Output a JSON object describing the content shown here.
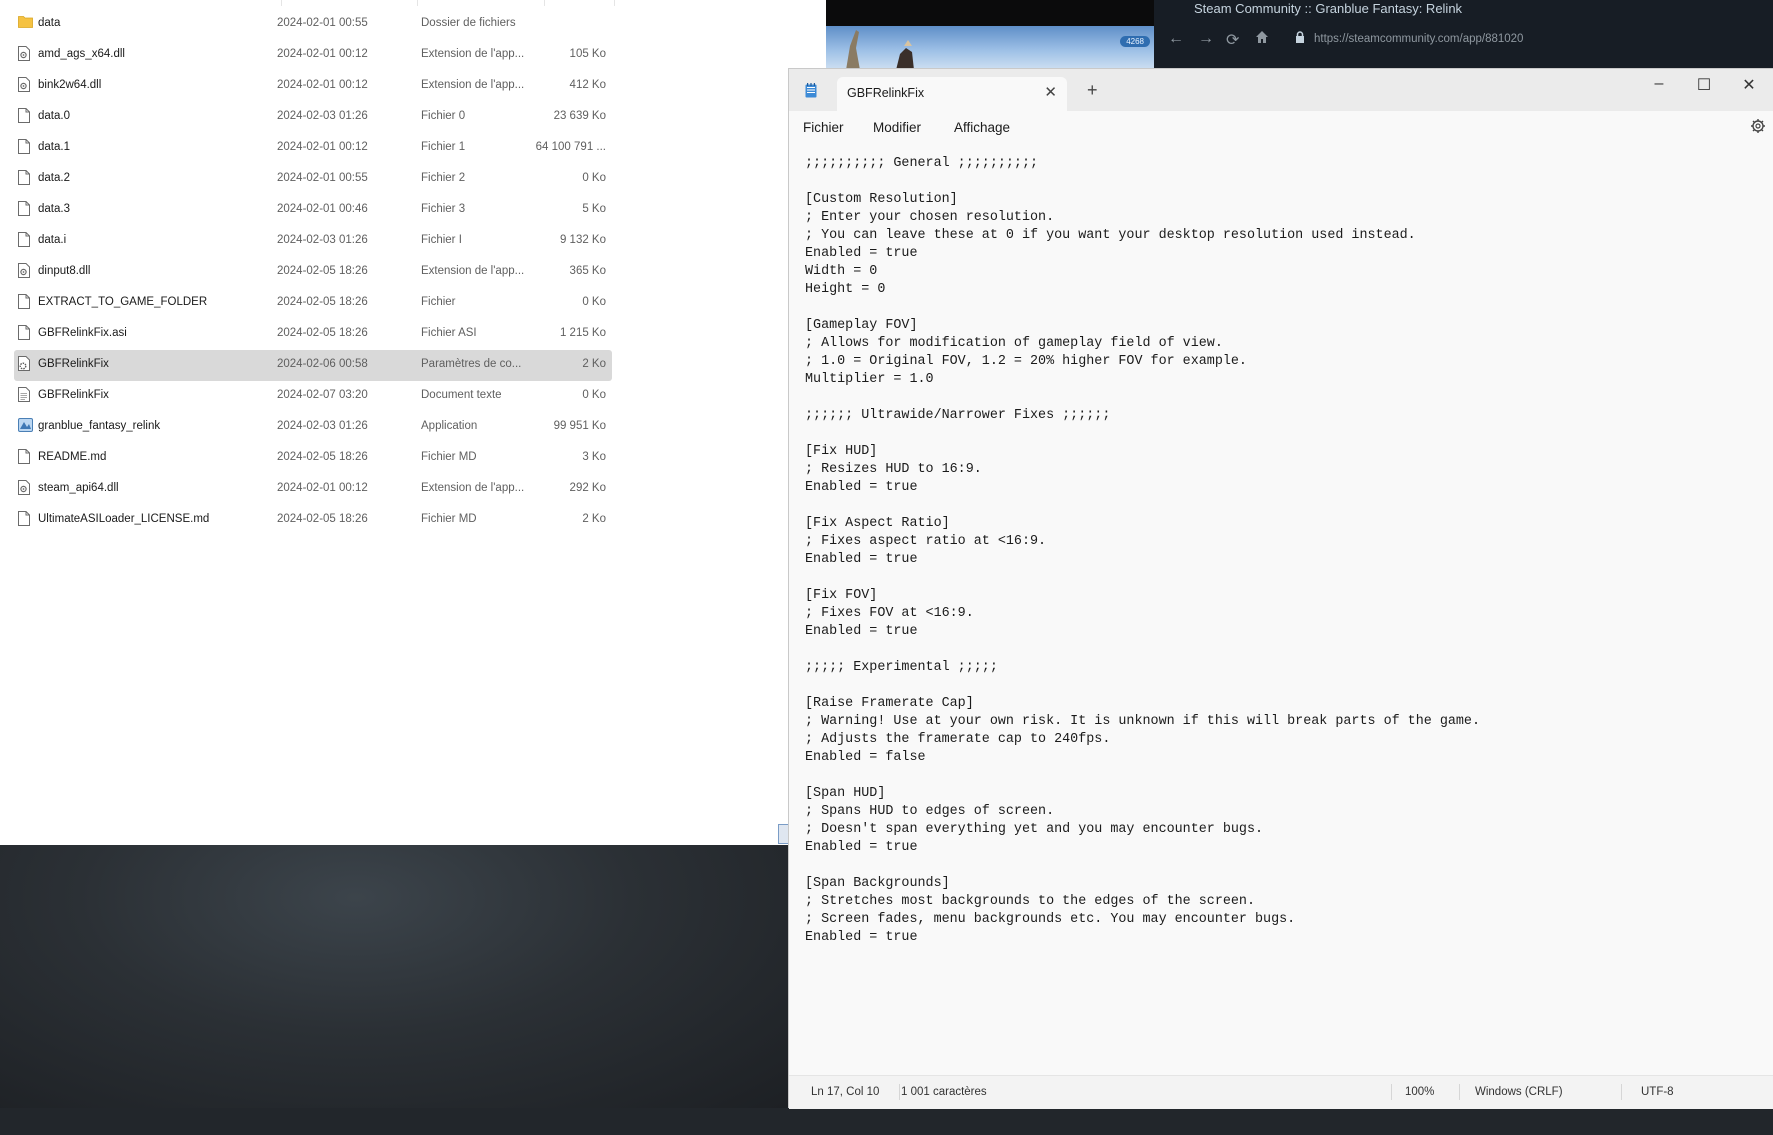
{
  "explorer": {
    "files": [
      {
        "name": "data",
        "date": "2024-02-01 00:55",
        "type": "Dossier de fichiers",
        "size": "",
        "icon": "folder-icon"
      },
      {
        "name": "amd_ags_x64.dll",
        "date": "2024-02-01 00:12",
        "type": "Extension de l'app...",
        "size": "105 Ko",
        "icon": "dll-file-icon"
      },
      {
        "name": "bink2w64.dll",
        "date": "2024-02-01 00:12",
        "type": "Extension de l'app...",
        "size": "412 Ko",
        "icon": "dll-file-icon"
      },
      {
        "name": "data.0",
        "date": "2024-02-03 01:26",
        "type": "Fichier 0",
        "size": "23 639 Ko",
        "icon": "file-icon"
      },
      {
        "name": "data.1",
        "date": "2024-02-01 00:12",
        "type": "Fichier 1",
        "size": "64 100 791 ...",
        "icon": "file-icon"
      },
      {
        "name": "data.2",
        "date": "2024-02-01 00:55",
        "type": "Fichier 2",
        "size": "0 Ko",
        "icon": "file-icon"
      },
      {
        "name": "data.3",
        "date": "2024-02-01 00:46",
        "type": "Fichier 3",
        "size": "5 Ko",
        "icon": "file-icon"
      },
      {
        "name": "data.i",
        "date": "2024-02-03 01:26",
        "type": "Fichier I",
        "size": "9 132 Ko",
        "icon": "file-icon"
      },
      {
        "name": "dinput8.dll",
        "date": "2024-02-05 18:26",
        "type": "Extension de l'app...",
        "size": "365 Ko",
        "icon": "dll-file-icon"
      },
      {
        "name": "EXTRACT_TO_GAME_FOLDER",
        "date": "2024-02-05 18:26",
        "type": "Fichier",
        "size": "0 Ko",
        "icon": "file-icon"
      },
      {
        "name": "GBFRelinkFix.asi",
        "date": "2024-02-05 18:26",
        "type": "Fichier ASI",
        "size": "1 215 Ko",
        "icon": "file-icon"
      },
      {
        "name": "GBFRelinkFix",
        "date": "2024-02-06 00:58",
        "type": "Paramètres de co...",
        "size": "2 Ko",
        "icon": "settings-file-icon",
        "selected": true
      },
      {
        "name": "GBFRelinkFix",
        "date": "2024-02-07 03:20",
        "type": "Document texte",
        "size": "0 Ko",
        "icon": "text-file-icon"
      },
      {
        "name": "granblue_fantasy_relink",
        "date": "2024-02-03 01:26",
        "type": "Application",
        "size": "99 951 Ko",
        "icon": "app-icon"
      },
      {
        "name": "README.md",
        "date": "2024-02-05 18:26",
        "type": "Fichier MD",
        "size": "3 Ko",
        "icon": "file-icon"
      },
      {
        "name": "steam_api64.dll",
        "date": "2024-02-01 00:12",
        "type": "Extension de l'app...",
        "size": "292 Ko",
        "icon": "dll-file-icon"
      },
      {
        "name": "UltimateASILoader_LICENSE.md",
        "date": "2024-02-05 18:26",
        "type": "Fichier MD",
        "size": "2 Ko",
        "icon": "file-icon"
      }
    ]
  },
  "game": {
    "hud_value": "4268"
  },
  "steam": {
    "title": "Steam Community :: Granblue Fantasy: Relink",
    "url": "https://steamcommunity.com/app/881020"
  },
  "notepad": {
    "tab_title": "GBFRelinkFix",
    "menu": {
      "file": "Fichier",
      "edit": "Modifier",
      "view": "Affichage"
    },
    "content": ";;;;;;;;;; General ;;;;;;;;;;\n\n[Custom Resolution]\n; Enter your chosen resolution.\n; You can leave these at 0 if you want your desktop resolution used instead.\nEnabled = true\nWidth = 0\nHeight = 0\n\n[Gameplay FOV]\n; Allows for modification of gameplay field of view.\n; 1.0 = Original FOV, 1.2 = 20% higher FOV for example.\nMultiplier = 1.0\n\n;;;;;; Ultrawide/Narrower Fixes ;;;;;;\n\n[Fix HUD]\n; Resizes HUD to 16:9.\nEnabled = true\n\n[Fix Aspect Ratio]\n; Fixes aspect ratio at <16:9.\nEnabled = true\n\n[Fix FOV]\n; Fixes FOV at <16:9.\nEnabled = true\n\n;;;;; Experimental ;;;;;\n\n[Raise Framerate Cap]\n; Warning! Use at your own risk. It is unknown if this will break parts of the game.\n; Adjusts the framerate cap to 240fps.\nEnabled = false\n\n[Span HUD]\n; Spans HUD to edges of screen.\n; Doesn't span everything yet and you may encounter bugs.\nEnabled = true\n\n[Span Backgrounds]\n; Stretches most backgrounds to the edges of the screen.\n; Screen fades, menu backgrounds etc. You may encounter bugs.\nEnabled = true",
    "status": {
      "position": "Ln 17, Col 10",
      "chars": "1 001 caractères",
      "zoom": "100%",
      "eol": "Windows (CRLF)",
      "encoding": "UTF-8"
    }
  },
  "colors": {
    "selected_row": "#d9d9d9",
    "folder": "#f5c242",
    "notepad_bg": "#f9f9f9"
  }
}
